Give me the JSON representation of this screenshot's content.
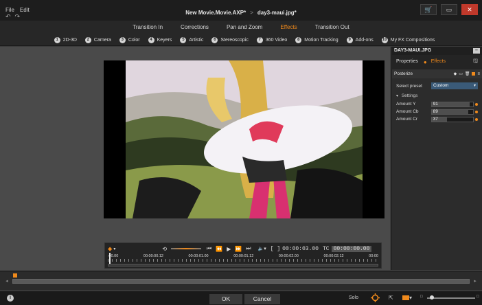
{
  "menu": [
    "File",
    "Edit"
  ],
  "titlebar": {
    "project": "New Movie.Movie.AXP*",
    "separator": ">",
    "clip": "day3-maui.jpg*"
  },
  "category_tabs": [
    {
      "label": "Transition In",
      "active": false
    },
    {
      "label": "Corrections",
      "active": false
    },
    {
      "label": "Pan and Zoom",
      "active": false
    },
    {
      "label": "Effects",
      "active": true
    },
    {
      "label": "Transition Out",
      "active": false
    }
  ],
  "effect_subtabs": [
    {
      "num": "1",
      "label": "2D-3D"
    },
    {
      "num": "2",
      "label": "Camera"
    },
    {
      "num": "3",
      "label": "Color"
    },
    {
      "num": "4",
      "label": "Keyers"
    },
    {
      "num": "5",
      "label": "Artistic"
    },
    {
      "num": "6",
      "label": "Stereoscopic"
    },
    {
      "num": "7",
      "label": "360 Video"
    },
    {
      "num": "8",
      "label": "Motion Tracking"
    },
    {
      "num": "9",
      "label": "Add-ons"
    },
    {
      "num": "10",
      "label": "My FX Compositions"
    }
  ],
  "transport": {
    "duration_prefix": "[ ]",
    "duration": "00:00:03.00",
    "tc_label": "TC",
    "timecode": "00:00:00.00",
    "ruler_labels": [
      ":00.00",
      "00:00:00.12",
      "00:00:01.00",
      "00:00:01.12",
      "00:00:02.00",
      "00:00:02.12",
      "00:00"
    ]
  },
  "panel": {
    "title": "DAY3-MAUI.JPG",
    "tabs": [
      {
        "label": "Properties",
        "active": false
      },
      {
        "label": "Effects",
        "active": true
      }
    ],
    "effect_name": "Posterize",
    "preset_label": "Select preset",
    "preset_value": "Custom",
    "settings_label": "Settings",
    "params": [
      {
        "label": "Amount Y",
        "value": "91",
        "level": 0.91
      },
      {
        "label": "Amount Cb",
        "value": "89",
        "level": 0.89
      },
      {
        "label": "Amount Cr",
        "value": "37",
        "level": 0.37
      }
    ]
  },
  "bottom": {
    "ok": "OK",
    "cancel": "Cancel",
    "solo": "Solo"
  },
  "colors": {
    "accent": "#f08a1c",
    "background": "#3a3a3a",
    "preset_select": "#3a5a78"
  }
}
